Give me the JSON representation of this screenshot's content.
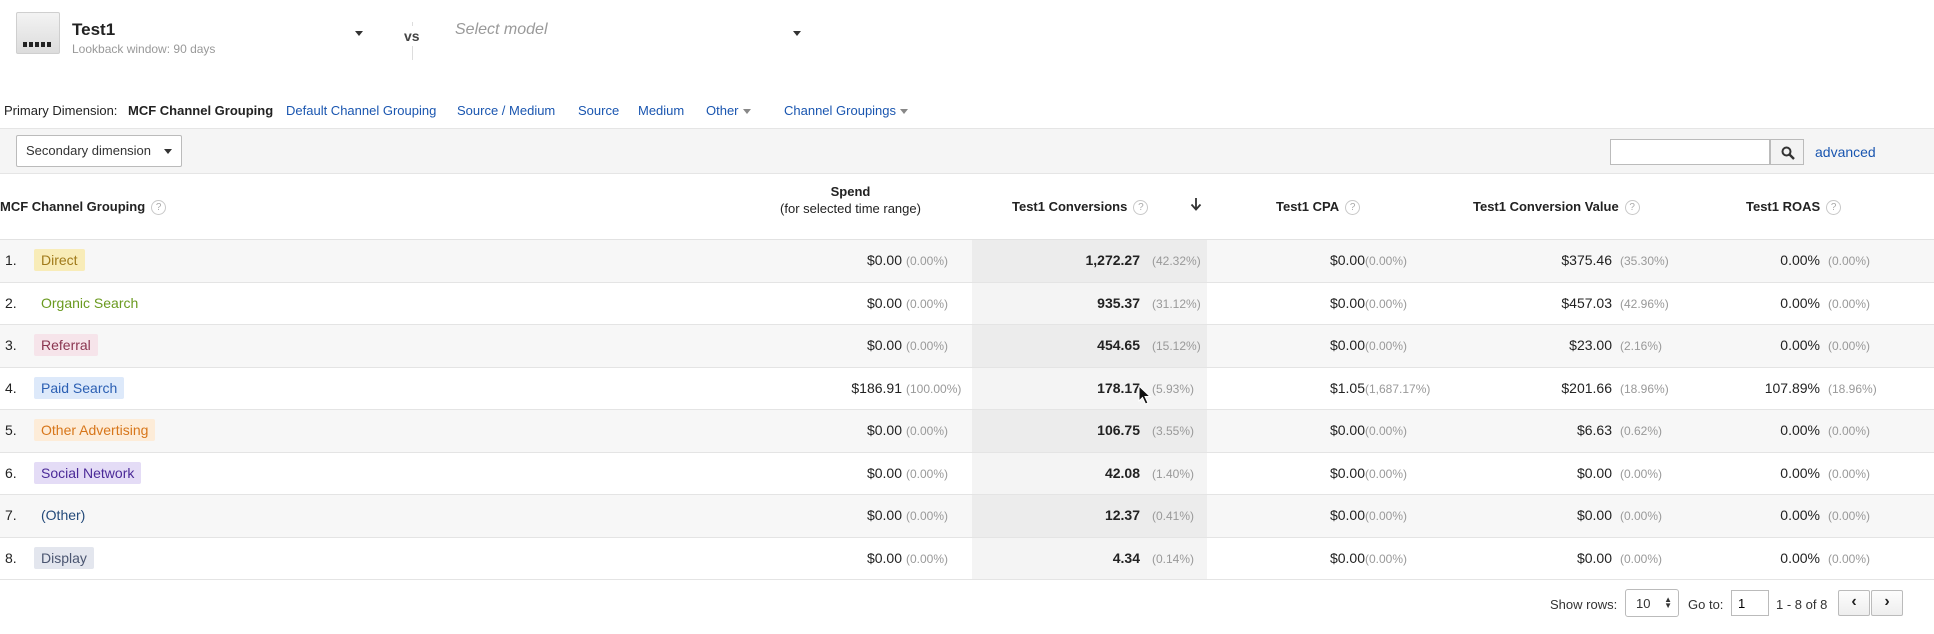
{
  "model": {
    "title": "Test1",
    "subtitle": "Lookback window: 90 days",
    "vs_label": "vs",
    "compare_placeholder": "Select model"
  },
  "primary_dimension": {
    "label": "Primary Dimension:",
    "active": "MCF Channel Grouping",
    "options": [
      "Default Channel Grouping",
      "Source / Medium",
      "Source",
      "Medium"
    ],
    "other_label": "Other",
    "channel_groupings_label": "Channel Groupings"
  },
  "toolbar": {
    "secondary_dimension_label": "Secondary dimension",
    "search_value": "",
    "advanced_label": "advanced"
  },
  "table": {
    "headers": {
      "dimension": "MCF Channel Grouping",
      "spend": "Spend",
      "spend_sub": "(for selected time range)",
      "conversions": "Test1 Conversions",
      "cpa": "Test1 CPA",
      "conversion_value": "Test1 Conversion Value",
      "roas": "Test1 ROAS",
      "help": "?"
    },
    "rows": [
      {
        "idx": "1.",
        "channel": "Direct",
        "chip_bg": "#f8ecb8",
        "chip_fg": "#a07a1a",
        "spend": "$0.00",
        "spend_pct": "(0.00%)",
        "conv": "1,272.27",
        "conv_pct": "(42.32%)",
        "cpa": "$0.00",
        "cpa_pct": "(0.00%)",
        "value": "$375.46",
        "value_pct": "(35.30%)",
        "roas": "0.00%",
        "roas_pct": "(0.00%)"
      },
      {
        "idx": "2.",
        "channel": "Organic Search",
        "chip_bg": "transparent",
        "chip_fg": "#6a9a1f",
        "spend": "$0.00",
        "spend_pct": "(0.00%)",
        "conv": "935.37",
        "conv_pct": "(31.12%)",
        "cpa": "$0.00",
        "cpa_pct": "(0.00%)",
        "value": "$457.03",
        "value_pct": "(42.96%)",
        "roas": "0.00%",
        "roas_pct": "(0.00%)"
      },
      {
        "idx": "3.",
        "channel": "Referral",
        "chip_bg": "#f6e4ea",
        "chip_fg": "#8a3550",
        "spend": "$0.00",
        "spend_pct": "(0.00%)",
        "conv": "454.65",
        "conv_pct": "(15.12%)",
        "cpa": "$0.00",
        "cpa_pct": "(0.00%)",
        "value": "$23.00",
        "value_pct": "(2.16%)",
        "roas": "0.00%",
        "roas_pct": "(0.00%)"
      },
      {
        "idx": "4.",
        "channel": "Paid Search",
        "chip_bg": "#dde9fa",
        "chip_fg": "#2b5fb3",
        "spend": "$186.91",
        "spend_pct": "(100.00%)",
        "conv": "178.17",
        "conv_pct": "(5.93%)",
        "cpa": "$1.05",
        "cpa_pct": "(1,687.17%)",
        "value": "$201.66",
        "value_pct": "(18.96%)",
        "roas": "107.89%",
        "roas_pct": "(18.96%)"
      },
      {
        "idx": "5.",
        "channel": "Other Advertising",
        "chip_bg": "#fdecd8",
        "chip_fg": "#d7761a",
        "spend": "$0.00",
        "spend_pct": "(0.00%)",
        "conv": "106.75",
        "conv_pct": "(3.55%)",
        "cpa": "$0.00",
        "cpa_pct": "(0.00%)",
        "value": "$6.63",
        "value_pct": "(0.62%)",
        "roas": "0.00%",
        "roas_pct": "(0.00%)"
      },
      {
        "idx": "6.",
        "channel": "Social Network",
        "chip_bg": "#e4dcf6",
        "chip_fg": "#4b2a98",
        "spend": "$0.00",
        "spend_pct": "(0.00%)",
        "conv": "42.08",
        "conv_pct": "(1.40%)",
        "cpa": "$0.00",
        "cpa_pct": "(0.00%)",
        "value": "$0.00",
        "value_pct": "(0.00%)",
        "roas": "0.00%",
        "roas_pct": "(0.00%)"
      },
      {
        "idx": "7.",
        "channel": "(Other)",
        "chip_bg": "transparent",
        "chip_fg": "#244a7a",
        "spend": "$0.00",
        "spend_pct": "(0.00%)",
        "conv": "12.37",
        "conv_pct": "(0.41%)",
        "cpa": "$0.00",
        "cpa_pct": "(0.00%)",
        "value": "$0.00",
        "value_pct": "(0.00%)",
        "roas": "0.00%",
        "roas_pct": "(0.00%)"
      },
      {
        "idx": "8.",
        "channel": "Display",
        "chip_bg": "#e3e6ee",
        "chip_fg": "#4a5570",
        "spend": "$0.00",
        "spend_pct": "(0.00%)",
        "conv": "4.34",
        "conv_pct": "(0.14%)",
        "cpa": "$0.00",
        "cpa_pct": "(0.00%)",
        "value": "$0.00",
        "value_pct": "(0.00%)",
        "roas": "0.00%",
        "roas_pct": "(0.00%)"
      }
    ]
  },
  "pagination": {
    "show_rows_label": "Show rows:",
    "show_rows_value": "10",
    "goto_label": "Go to:",
    "goto_value": "1",
    "range_label": "1 - 8 of 8",
    "prev": "‹",
    "next": "›"
  },
  "colors": {
    "link": "#1a56b0",
    "toolbar_bg": "#f5f5f5"
  }
}
